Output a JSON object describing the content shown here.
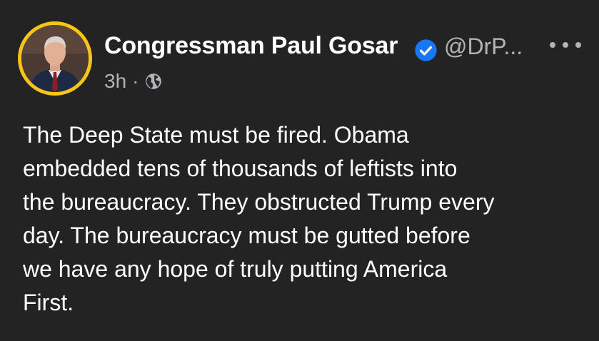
{
  "post": {
    "author": {
      "name": "Congressman Paul Gosar",
      "handle": "@DrP...",
      "verified_icon": "verified-badge-icon",
      "avatar_ring_color": "#f5c518",
      "verified_color": "#1877f2"
    },
    "meta": {
      "time": "3h",
      "separator": "·",
      "audience_icon": "globe-icon"
    },
    "more_icon": "more-dots-icon",
    "text_lines": [
      "The Deep State must be fired. Obama",
      "embedded tens of thousands of leftists into",
      "the bureaucracy. They obstructed Trump every",
      "day. The bureaucracy must be gutted before",
      "we have any hope of truly putting America",
      "First."
    ]
  }
}
